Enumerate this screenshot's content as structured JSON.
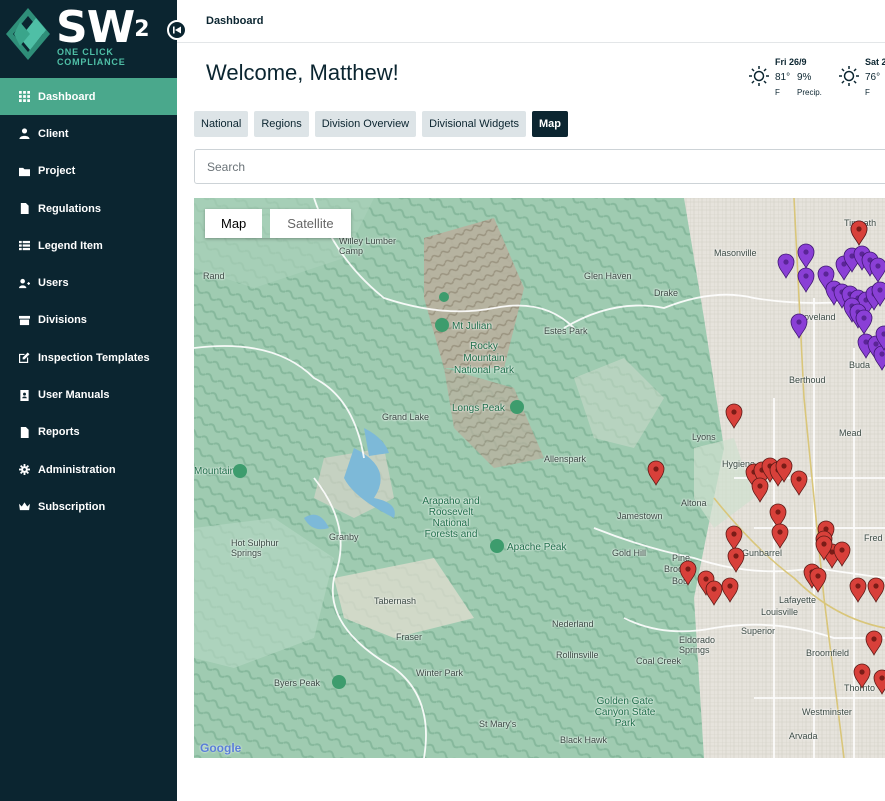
{
  "brand": {
    "name": "SW",
    "superscript": "2",
    "tagline": "ONE CLICK COMPLIANCE",
    "colors": {
      "sidebar": "#0b2530",
      "accent": "#4aa88c",
      "teal": "#4fbfa6"
    }
  },
  "sidebar": {
    "items": [
      {
        "label": "Dashboard",
        "icon": "grid-icon",
        "active": true
      },
      {
        "label": "Client",
        "icon": "user-icon"
      },
      {
        "label": "Project",
        "icon": "folder-icon"
      },
      {
        "label": "Regulations",
        "icon": "document-icon"
      },
      {
        "label": "Legend Item",
        "icon": "list-icon"
      },
      {
        "label": "Users",
        "icon": "users-icon"
      },
      {
        "label": "Divisions",
        "icon": "archive-icon"
      },
      {
        "label": "Inspection Templates",
        "icon": "edit-icon"
      },
      {
        "label": "User Manuals",
        "icon": "book-icon"
      },
      {
        "label": "Reports",
        "icon": "file-icon"
      },
      {
        "label": "Administration",
        "icon": "gear-icon"
      },
      {
        "label": "Subscription",
        "icon": "crown-icon"
      }
    ]
  },
  "header": {
    "breadcrumb": "Dashboard",
    "welcome": "Welcome, Matthew!"
  },
  "weather": [
    {
      "date": "Fri 26/9",
      "temp": "81°",
      "unit": "F",
      "precip": "9%",
      "precip_label": "Precip."
    },
    {
      "date": "Sat 2",
      "temp": "76°",
      "unit": "F",
      "precip": "",
      "precip_label": ""
    }
  ],
  "tabs": [
    {
      "label": "National"
    },
    {
      "label": "Regions"
    },
    {
      "label": "Division Overview"
    },
    {
      "label": "Divisional Widgets"
    },
    {
      "label": "Map",
      "active": true
    }
  ],
  "search": {
    "placeholder": "Search"
  },
  "map": {
    "type_map": "Map",
    "type_satellite": "Satellite",
    "attribution": "Google",
    "pin_colors": {
      "purple": "#8a3fd6",
      "red": "#d8403a"
    },
    "labels": [
      "Willey Lumber Camp",
      "Rand",
      "Glen Haven",
      "Masonville",
      "Drake",
      "Mt Julian",
      "Rocky Mountain National Park",
      "Estes Park",
      "Loveland",
      "Berthoud",
      "Buda",
      "Grand Lake",
      "Longs Peak",
      "Lyons",
      "Mead",
      "Allenspark",
      "Hygiene",
      "Mountain",
      "Arapaho and Roosevelt National Forests and",
      "Jamestown",
      "Altona",
      "Apache Peak",
      "Gold Hill",
      "Gunbarrel",
      "Fred",
      "Hot Sulphur Springs",
      "Granby",
      "Tabernash",
      "Nederland",
      "Louisville",
      "Lafayette",
      "Superior",
      "Fraser",
      "Eldorado Springs",
      "Broomfield",
      "Rollinsville",
      "Coal Creek",
      "Byers Peak",
      "Winter Park",
      "Golden Gate Canyon State Park",
      "Westminster",
      "Thornto",
      "St Mary's",
      "Black Hawk",
      "Arvada",
      "Timnath",
      "Pine",
      "Brook",
      "Boul"
    ]
  }
}
